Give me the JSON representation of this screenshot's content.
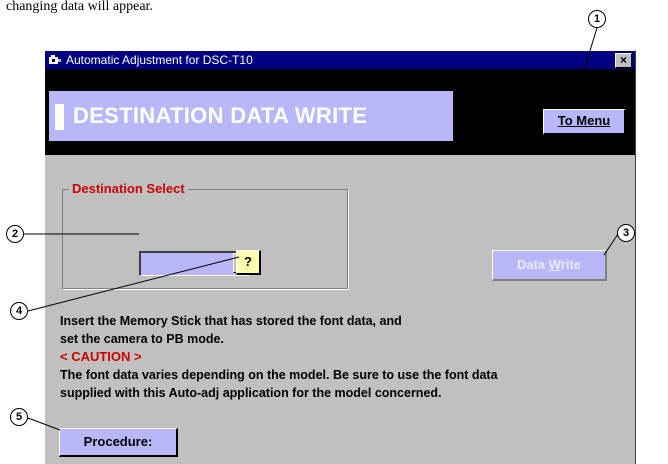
{
  "doc": {
    "caption": "changing data will appear."
  },
  "callouts": {
    "c1": "1",
    "c2": "2",
    "c3": "3",
    "c4": "4",
    "c5": "5"
  },
  "window": {
    "title": "Automatic Adjustment for DSC-T10",
    "close_label": "×",
    "heading": "DESTINATION DATA WRITE",
    "to_menu_label": "To Menu"
  },
  "destination": {
    "group_label": "Destination Select",
    "selected_value": "",
    "help_label": "?"
  },
  "actions": {
    "data_write_pre": "Data ",
    "data_write_ul": "W",
    "data_write_post": "rite",
    "procedure_label": "Procedure:"
  },
  "messages": {
    "line1": "Insert the Memory Stick that has stored the font data, and",
    "line2": "set the camera to PB mode.",
    "caution": "< CAUTION >",
    "line3": "The font data varies depending on the model. Be sure to use the font data",
    "line4": "supplied with this Auto-adj application for the model concerned."
  },
  "colors": {
    "title_bar": "#000080",
    "accent": "#b8b8f8",
    "help_button": "#ffffb0",
    "caution": "#cc0000",
    "window_bg": "#c0c0c0"
  }
}
